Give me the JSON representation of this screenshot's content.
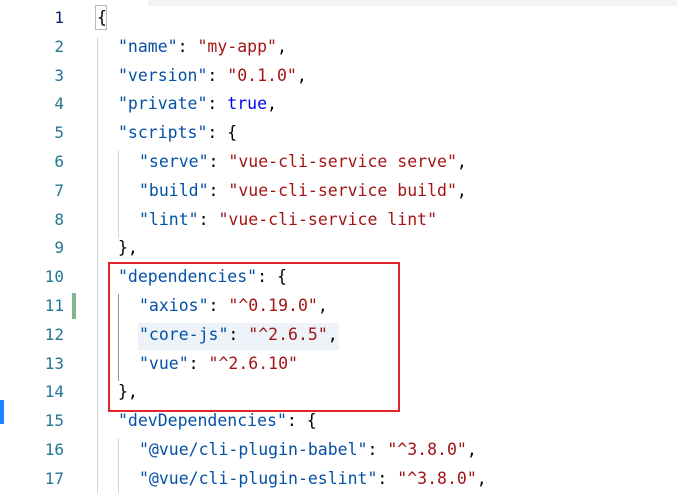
{
  "editor": {
    "file_language": "json",
    "line_numbers": [
      "1",
      "2",
      "3",
      "4",
      "5",
      "6",
      "7",
      "8",
      "9",
      "10",
      "11",
      "12",
      "13",
      "14",
      "15",
      "16",
      "17"
    ],
    "lines": [
      {
        "indent": 0,
        "tokens": [
          {
            "t": "{",
            "c": "p"
          }
        ]
      },
      {
        "indent": 1,
        "tokens": [
          {
            "t": "\"name\"",
            "c": "k"
          },
          {
            "t": ": ",
            "c": "p"
          },
          {
            "t": "\"my-app\"",
            "c": "s"
          },
          {
            "t": ",",
            "c": "p"
          }
        ]
      },
      {
        "indent": 1,
        "tokens": [
          {
            "t": "\"version\"",
            "c": "k"
          },
          {
            "t": ": ",
            "c": "p"
          },
          {
            "t": "\"0.1.0\"",
            "c": "s"
          },
          {
            "t": ",",
            "c": "p"
          }
        ]
      },
      {
        "indent": 1,
        "tokens": [
          {
            "t": "\"private\"",
            "c": "k"
          },
          {
            "t": ": ",
            "c": "p"
          },
          {
            "t": "true",
            "c": "b"
          },
          {
            "t": ",",
            "c": "p"
          }
        ]
      },
      {
        "indent": 1,
        "tokens": [
          {
            "t": "\"scripts\"",
            "c": "k"
          },
          {
            "t": ": {",
            "c": "p"
          }
        ]
      },
      {
        "indent": 2,
        "tokens": [
          {
            "t": "\"serve\"",
            "c": "k"
          },
          {
            "t": ": ",
            "c": "p"
          },
          {
            "t": "\"vue-cli-service serve\"",
            "c": "s"
          },
          {
            "t": ",",
            "c": "p"
          }
        ]
      },
      {
        "indent": 2,
        "tokens": [
          {
            "t": "\"build\"",
            "c": "k"
          },
          {
            "t": ": ",
            "c": "p"
          },
          {
            "t": "\"vue-cli-service build\"",
            "c": "s"
          },
          {
            "t": ",",
            "c": "p"
          }
        ]
      },
      {
        "indent": 2,
        "tokens": [
          {
            "t": "\"lint\"",
            "c": "k"
          },
          {
            "t": ": ",
            "c": "p"
          },
          {
            "t": "\"vue-cli-service lint\"",
            "c": "s"
          }
        ]
      },
      {
        "indent": 1,
        "tokens": [
          {
            "t": "},",
            "c": "p"
          }
        ]
      },
      {
        "indent": 1,
        "tokens": [
          {
            "t": "\"dependencies\"",
            "c": "k"
          },
          {
            "t": ": {",
            "c": "p"
          }
        ]
      },
      {
        "indent": 2,
        "tokens": [
          {
            "t": "\"axios\"",
            "c": "k"
          },
          {
            "t": ": ",
            "c": "p"
          },
          {
            "t": "\"^0.19.0\"",
            "c": "s"
          },
          {
            "t": ",",
            "c": "p"
          }
        ]
      },
      {
        "indent": 2,
        "tokens": [
          {
            "t": "\"core-js\"",
            "c": "k"
          },
          {
            "t": ": ",
            "c": "p"
          },
          {
            "t": "\"^2.6.5\"",
            "c": "s"
          },
          {
            "t": ",",
            "c": "p"
          }
        ]
      },
      {
        "indent": 2,
        "tokens": [
          {
            "t": "\"vue\"",
            "c": "k"
          },
          {
            "t": ": ",
            "c": "p"
          },
          {
            "t": "\"^2.6.10\"",
            "c": "s"
          }
        ]
      },
      {
        "indent": 1,
        "tokens": [
          {
            "t": "},",
            "c": "p"
          }
        ]
      },
      {
        "indent": 1,
        "tokens": [
          {
            "t": "\"devDependencies\"",
            "c": "k"
          },
          {
            "t": ": {",
            "c": "p"
          }
        ]
      },
      {
        "indent": 2,
        "tokens": [
          {
            "t": "\"@vue/cli-plugin-babel\"",
            "c": "k"
          },
          {
            "t": ": ",
            "c": "p"
          },
          {
            "t": "\"^3.8.0\"",
            "c": "s"
          },
          {
            "t": ",",
            "c": "p"
          }
        ]
      },
      {
        "indent": 2,
        "tokens": [
          {
            "t": "\"@vue/cli-plugin-eslint\"",
            "c": "k"
          },
          {
            "t": ": ",
            "c": "p"
          },
          {
            "t": "\"^3.8.0\"",
            "c": "s"
          },
          {
            "t": ",",
            "c": "p"
          }
        ]
      }
    ]
  },
  "colors": {
    "key": "#0451a5",
    "string": "#a31515",
    "boolean": "#0000ff",
    "line_number": "#237893",
    "highlight_box": "#e0262b",
    "modified_marker": "#81b88b"
  }
}
